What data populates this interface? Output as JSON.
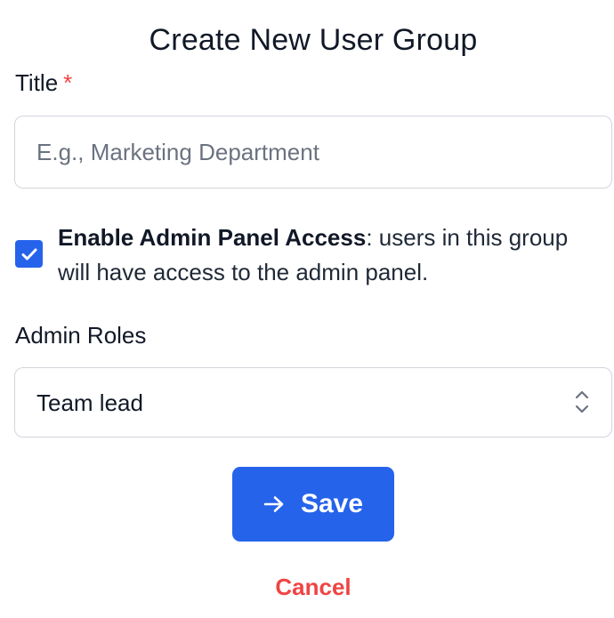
{
  "form": {
    "heading": "Create New User Group",
    "title_field": {
      "label": "Title",
      "required_marker": "*",
      "value": "",
      "placeholder": "E.g., Marketing Department"
    },
    "admin_access": {
      "checked": true,
      "label_strong": "Enable Admin Panel Access",
      "label_rest": ": users in this group will have access to the admin panel."
    },
    "admin_roles": {
      "label": "Admin Roles",
      "selected": "Team lead"
    },
    "save_label": "Save",
    "cancel_label": "Cancel"
  },
  "colors": {
    "primary": "#2563eb",
    "danger": "#ef4444",
    "border": "#d1d5db",
    "placeholder": "#6b7280",
    "text": "#111827"
  },
  "icons": {
    "checkbox": "check-icon",
    "select": "chevron-up-down-icon",
    "save": "arrow-right-icon"
  }
}
